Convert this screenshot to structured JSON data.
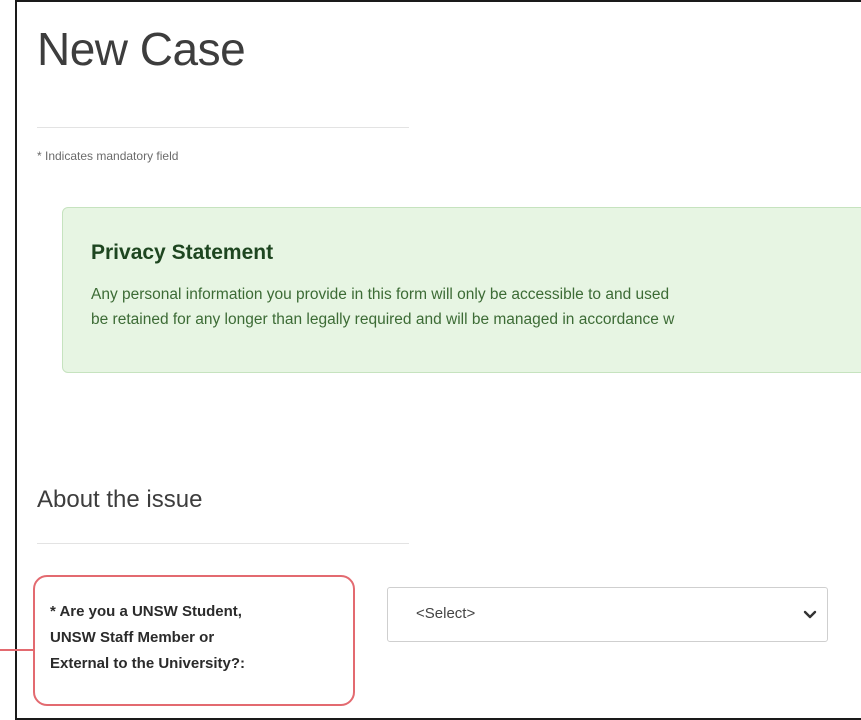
{
  "page": {
    "title": "New Case",
    "mandatory_note": "* Indicates mandatory field"
  },
  "privacy": {
    "heading": "Privacy Statement",
    "line1": "Any personal information you provide in this form will only be accessible to and used",
    "line2": "be retained for any longer than legally required and will be managed in accordance w"
  },
  "section": {
    "title": "About the issue"
  },
  "field": {
    "label_line1": "* Are you a UNSW Student,",
    "label_line2": "UNSW Staff Member or",
    "label_line3": "External to the University?:",
    "select_value": "<Select>"
  },
  "colors": {
    "privacy_bg": "#e7f5e3",
    "privacy_heading": "#1e4620",
    "highlight": "#e36a70"
  }
}
